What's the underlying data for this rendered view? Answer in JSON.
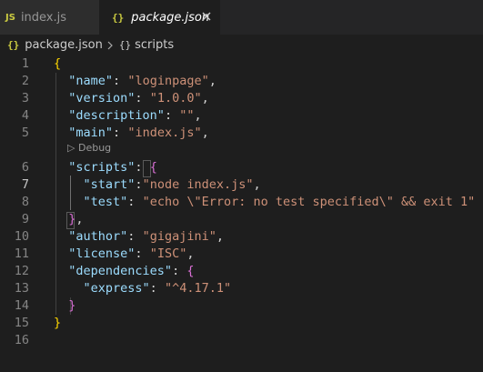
{
  "tabs": [
    {
      "icon": "JS",
      "label": "index.js"
    },
    {
      "icon": "{}",
      "label": "package.json"
    }
  ],
  "breadcrumb": {
    "file": "package.json",
    "symbol": "scripts"
  },
  "codelens": "Debug",
  "lines": [
    {
      "num": "1",
      "tokens": [
        {
          "t": "{",
          "c": "br"
        }
      ]
    },
    {
      "num": "2",
      "tokens": [
        {
          "t": "  ",
          "c": "p"
        },
        {
          "t": "\"name\"",
          "c": "k"
        },
        {
          "t": ": ",
          "c": "p"
        },
        {
          "t": "\"loginpage\"",
          "c": "s"
        },
        {
          "t": ",",
          "c": "p"
        }
      ]
    },
    {
      "num": "3",
      "tokens": [
        {
          "t": "  ",
          "c": "p"
        },
        {
          "t": "\"version\"",
          "c": "k"
        },
        {
          "t": ": ",
          "c": "p"
        },
        {
          "t": "\"1.0.0\"",
          "c": "s"
        },
        {
          "t": ",",
          "c": "p"
        }
      ]
    },
    {
      "num": "4",
      "tokens": [
        {
          "t": "  ",
          "c": "p"
        },
        {
          "t": "\"description\"",
          "c": "k"
        },
        {
          "t": ": ",
          "c": "p"
        },
        {
          "t": "\"\"",
          "c": "s"
        },
        {
          "t": ",",
          "c": "p"
        }
      ]
    },
    {
      "num": "5",
      "tokens": [
        {
          "t": "  ",
          "c": "p"
        },
        {
          "t": "\"main\"",
          "c": "k"
        },
        {
          "t": ": ",
          "c": "p"
        },
        {
          "t": "\"index.js\"",
          "c": "s"
        },
        {
          "t": ",",
          "c": "p"
        }
      ]
    },
    {
      "num": "6",
      "tokens": [
        {
          "t": "  ",
          "c": "p"
        },
        {
          "t": "\"scripts\"",
          "c": "k"
        },
        {
          "t": ": ",
          "c": "p"
        },
        {
          "t": "{",
          "c": "br2"
        }
      ]
    },
    {
      "num": "7",
      "tokens": [
        {
          "t": "    ",
          "c": "p"
        },
        {
          "t": "\"start\"",
          "c": "k"
        },
        {
          "t": ":",
          "c": "p"
        },
        {
          "t": "\"node index.js\"",
          "c": "s"
        },
        {
          "t": ",",
          "c": "p"
        }
      ]
    },
    {
      "num": "8",
      "tokens": [
        {
          "t": "    ",
          "c": "p"
        },
        {
          "t": "\"test\"",
          "c": "k"
        },
        {
          "t": ": ",
          "c": "p"
        },
        {
          "t": "\"echo \\\"Error: no test specified\\\" && exit 1\"",
          "c": "s"
        }
      ]
    },
    {
      "num": "9",
      "tokens": [
        {
          "t": "  ",
          "c": "p"
        },
        {
          "t": "}",
          "c": "br2"
        },
        {
          "t": ",",
          "c": "p"
        }
      ]
    },
    {
      "num": "10",
      "tokens": [
        {
          "t": "  ",
          "c": "p"
        },
        {
          "t": "\"author\"",
          "c": "k"
        },
        {
          "t": ": ",
          "c": "p"
        },
        {
          "t": "\"gigajini\"",
          "c": "s"
        },
        {
          "t": ",",
          "c": "p"
        }
      ]
    },
    {
      "num": "11",
      "tokens": [
        {
          "t": "  ",
          "c": "p"
        },
        {
          "t": "\"license\"",
          "c": "k"
        },
        {
          "t": ": ",
          "c": "p"
        },
        {
          "t": "\"ISC\"",
          "c": "s"
        },
        {
          "t": ",",
          "c": "p"
        }
      ]
    },
    {
      "num": "12",
      "tokens": [
        {
          "t": "  ",
          "c": "p"
        },
        {
          "t": "\"dependencies\"",
          "c": "k"
        },
        {
          "t": ": ",
          "c": "p"
        },
        {
          "t": "{",
          "c": "br2"
        }
      ]
    },
    {
      "num": "13",
      "tokens": [
        {
          "t": "    ",
          "c": "p"
        },
        {
          "t": "\"express\"",
          "c": "k"
        },
        {
          "t": ": ",
          "c": "p"
        },
        {
          "t": "\"^4.17.1\"",
          "c": "s"
        }
      ]
    },
    {
      "num": "14",
      "tokens": [
        {
          "t": "  ",
          "c": "p"
        },
        {
          "t": "}",
          "c": "br2"
        }
      ]
    },
    {
      "num": "15",
      "tokens": [
        {
          "t": "}",
          "c": "br"
        }
      ]
    },
    {
      "num": "16",
      "tokens": []
    }
  ],
  "active_line": "7",
  "colors": {
    "background": "#1e1e1e",
    "key": "#9cdcfe",
    "string": "#ce9178",
    "bracket_outer": "#ffd700",
    "bracket_inner": "#da70d6",
    "json_icon": "#cbcb41"
  }
}
